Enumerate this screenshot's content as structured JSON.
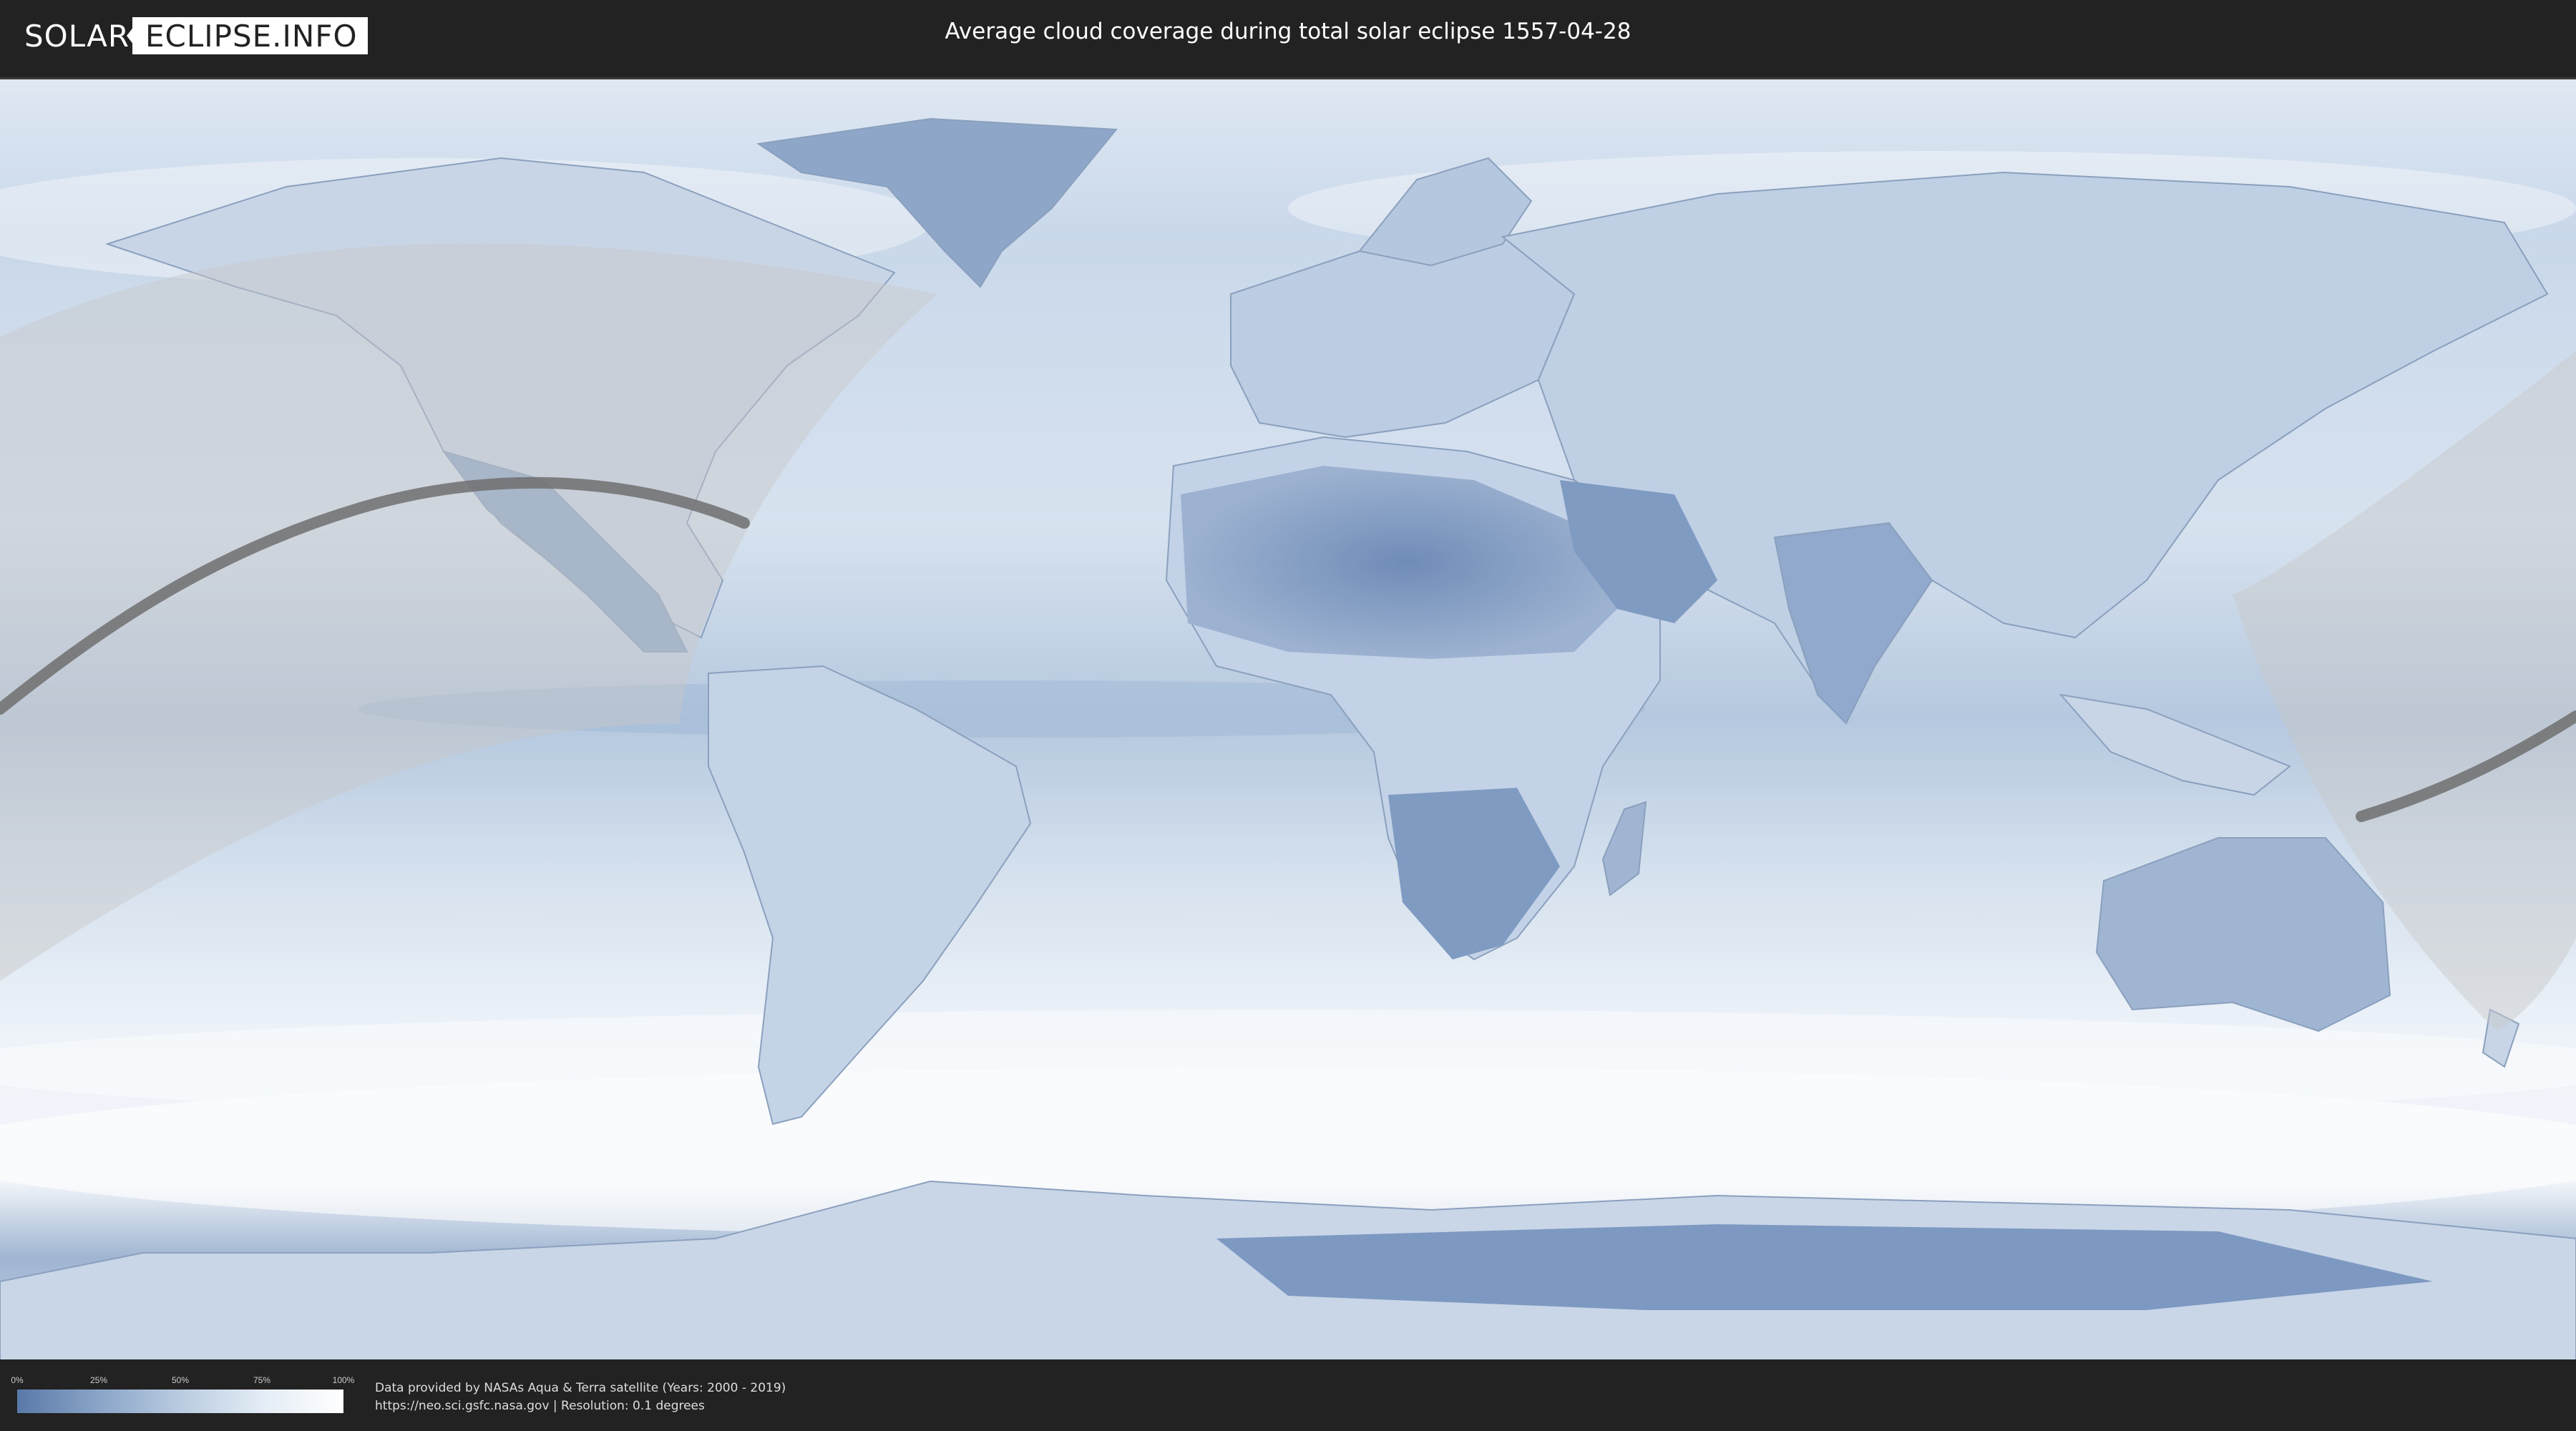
{
  "header": {
    "logo_left": "SOLAR",
    "logo_right": "ECLIPSE.INFO",
    "title": "Average cloud coverage during total solar eclipse 1557-04-28"
  },
  "legend": {
    "ticks": [
      "0%",
      "25%",
      "50%",
      "75%",
      "100%"
    ],
    "color_low": "#5a79a8",
    "color_high": "#ffffff"
  },
  "credits": {
    "line1": "Data provided by NASAs Aqua & Terra satellite (Years: 2000 - 2019)",
    "line2": "https://neo.sci.gsfc.nasa.gov | Resolution: 0.1 degrees"
  },
  "colors": {
    "background": "#222222",
    "cloud_clear": "#6f8db8",
    "cloud_full": "#f4f7fb",
    "path": "#6e6e6e",
    "visibility_zone": "#c8c8c8"
  }
}
